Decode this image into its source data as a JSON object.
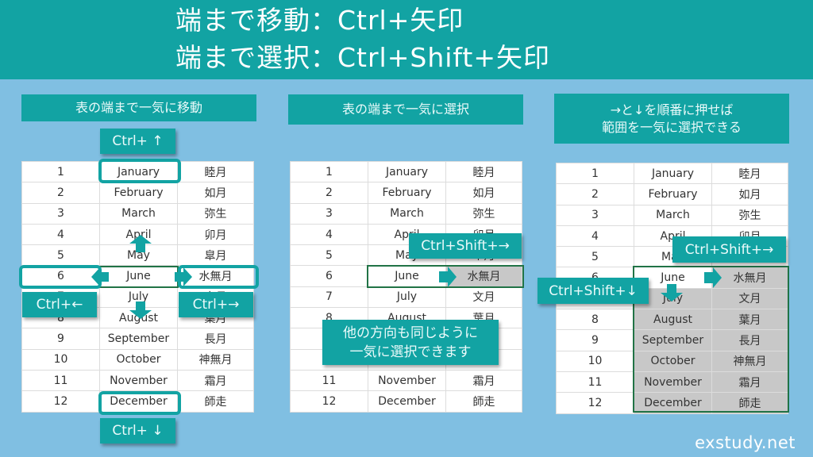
{
  "header": {
    "line1": "端まで移動：Ctrl+矢印",
    "line2": "端まで選択：Ctrl+Shift+矢印"
  },
  "panels": [
    {
      "title": "表の端まで一気に移動",
      "keys": {
        "up": "Ctrl+ ↑",
        "down": "Ctrl+ ↓",
        "left": "Ctrl+←",
        "right": "Ctrl+→"
      }
    },
    {
      "title": "表の端まで一気に選択",
      "keys": {
        "right": "Ctrl+Shift+→"
      },
      "note_line1": "他の方向も同じように",
      "note_line2": "一気に選択できます"
    },
    {
      "title_line1": "→と↓を順番に押せば",
      "title_line2": "範囲を一気に選択できる",
      "keys": {
        "right": "Ctrl+Shift+→",
        "down": "Ctrl+Shift+↓"
      }
    }
  ],
  "table": {
    "rows": [
      [
        "1",
        "January",
        "睦月"
      ],
      [
        "2",
        "February",
        "如月"
      ],
      [
        "3",
        "March",
        "弥生"
      ],
      [
        "4",
        "April",
        "卯月"
      ],
      [
        "5",
        "May",
        "皐月"
      ],
      [
        "6",
        "June",
        "水無月"
      ],
      [
        "7",
        "July",
        "文月"
      ],
      [
        "8",
        "August",
        "葉月"
      ],
      [
        "9",
        "September",
        "長月"
      ],
      [
        "10",
        "October",
        "神無月"
      ],
      [
        "11",
        "November",
        "霜月"
      ],
      [
        "12",
        "December",
        "師走"
      ]
    ]
  },
  "colors": {
    "accent": "#12a3a3",
    "background": "#80bfe2",
    "selection": "#c8c8c8",
    "active_cell_border": "#217346"
  },
  "credit": "exstudy.net"
}
